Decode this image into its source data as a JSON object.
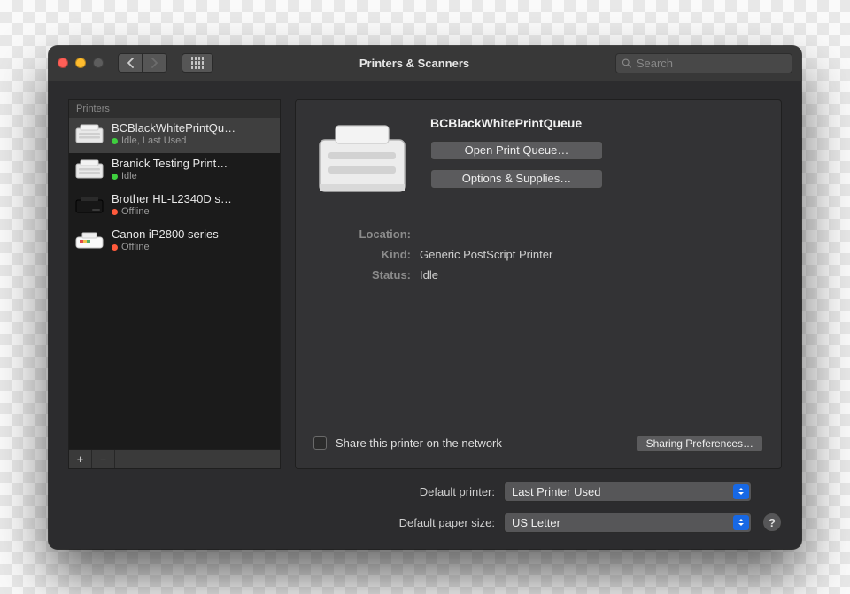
{
  "window": {
    "title": "Printers & Scanners"
  },
  "search": {
    "placeholder": "Search"
  },
  "sidebar": {
    "header": "Printers",
    "items": [
      {
        "name": "BCBlackWhitePrintQu…",
        "status": "Idle, Last Used",
        "led": "green",
        "icon": "laser",
        "selected": true
      },
      {
        "name": "Branick Testing Print…",
        "status": "Idle",
        "led": "green",
        "icon": "laser",
        "selected": false
      },
      {
        "name": "Brother HL-L2340D s…",
        "status": "Offline",
        "led": "red",
        "icon": "dark",
        "selected": false
      },
      {
        "name": "Canon iP2800 series",
        "status": "Offline",
        "led": "red",
        "icon": "inkjet",
        "selected": false
      }
    ],
    "add": "+",
    "remove": "−"
  },
  "detail": {
    "name": "BCBlackWhitePrintQueue",
    "open_queue": "Open Print Queue…",
    "options": "Options & Supplies…",
    "location_label": "Location:",
    "location_value": "",
    "kind_label": "Kind:",
    "kind_value": "Generic PostScript Printer",
    "status_label": "Status:",
    "status_value": "Idle",
    "share_label": "Share this printer on the network",
    "sharing_btn": "Sharing Preferences…"
  },
  "defaults": {
    "printer_label": "Default printer:",
    "printer_value": "Last Printer Used",
    "paper_label": "Default paper size:",
    "paper_value": "US Letter"
  },
  "help": "?"
}
